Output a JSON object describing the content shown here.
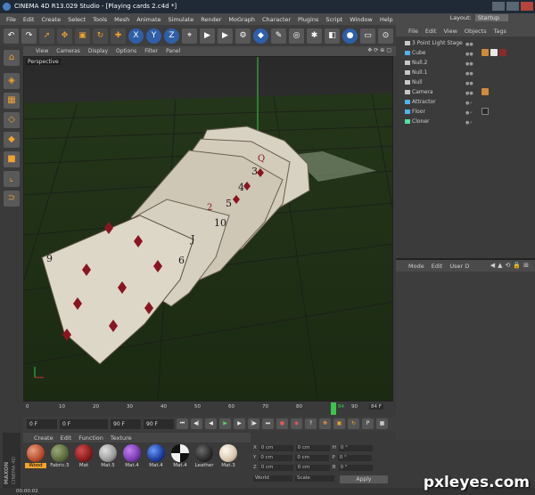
{
  "title": {
    "text": "CINEMA 4D R13.029 Studio - [Playing cards 2.c4d *]"
  },
  "menu": [
    "File",
    "Edit",
    "Create",
    "Select",
    "Tools",
    "Mesh",
    "Animate",
    "Simulate",
    "Render",
    "MoGraph",
    "Character",
    "Plugins",
    "Script",
    "Window",
    "Help"
  ],
  "layout": {
    "label": "Layout:",
    "value": "Startup"
  },
  "viewport": {
    "menu": [
      "View",
      "Cameras",
      "Display",
      "Options",
      "Filter",
      "Panel"
    ],
    "label": "Perspective"
  },
  "objects": {
    "menu": [
      "File",
      "Edit",
      "View",
      "Objects",
      "Tags"
    ],
    "items": [
      {
        "name": "3 Point Light Stage",
        "icon": "group-icon",
        "color": "#c8c8c8"
      },
      {
        "name": "Cube",
        "icon": "cube-icon",
        "color": "#4fb4e8"
      },
      {
        "name": "Null.2",
        "icon": "null-icon",
        "color": "#c8c8c8"
      },
      {
        "name": "Null.1",
        "icon": "null-icon",
        "color": "#c8c8c8"
      },
      {
        "name": "Null",
        "icon": "null-icon",
        "color": "#c8c8c8"
      },
      {
        "name": "Camera",
        "icon": "camera-icon",
        "color": "#c8c8c8"
      },
      {
        "name": "Attractor",
        "icon": "attractor-icon",
        "color": "#4fb4e8"
      },
      {
        "name": "Floor",
        "icon": "floor-icon",
        "color": "#4fb4e8"
      },
      {
        "name": "Cloner",
        "icon": "cloner-icon",
        "color": "#4fe0a0"
      }
    ]
  },
  "attributes": {
    "menu": [
      "Mode",
      "Edit",
      "User D"
    ]
  },
  "timeline": {
    "ticks": [
      "0",
      "10",
      "20",
      "30",
      "40",
      "50",
      "60",
      "70",
      "80",
      "84",
      "90"
    ],
    "end_label": "84 F",
    "current_frame": 84,
    "max_frame": 90
  },
  "transport": {
    "start": "0 F",
    "current": "0 F",
    "end": "90 F",
    "max": "90 F"
  },
  "materials": {
    "menu": [
      "Create",
      "Edit",
      "Function",
      "Texture"
    ],
    "items": [
      {
        "label": "Wood",
        "color": "#b84a2a",
        "selected": true
      },
      {
        "label": "Fabric.5",
        "color": "#5a6a3a"
      },
      {
        "label": "Mat",
        "color": "#8a1a1a"
      },
      {
        "label": "Mat.5",
        "color": "#9a9a9a"
      },
      {
        "label": "Mat.4",
        "color": "#7a3ab4"
      },
      {
        "label": "Mat.4",
        "color": "#1a3a9a"
      },
      {
        "label": "Mat.4",
        "color": "#e8e8e8"
      },
      {
        "label": "Leather",
        "color": "#2a2a2a"
      },
      {
        "label": "Mat.3",
        "color": "#d8c8b0"
      }
    ]
  },
  "coordinates": {
    "rows": [
      {
        "axis": "X",
        "pos": "0 cm",
        "size": "0 cm",
        "rotlabel": "H",
        "rot": "0 °"
      },
      {
        "axis": "Y",
        "pos": "0 cm",
        "size": "0 cm",
        "rotlabel": "P",
        "rot": "0 °"
      },
      {
        "axis": "Z",
        "pos": "0 cm",
        "size": "0 cm",
        "rotlabel": "B",
        "rot": "0 °"
      }
    ],
    "mode1": "World",
    "mode2": "Scale",
    "apply": "Apply"
  },
  "brand": {
    "line1": "MAXON",
    "line2": "CINEMA 4D"
  },
  "status": {
    "text": "00:00:02"
  },
  "watermark": {
    "text": "pxleyes.com"
  }
}
